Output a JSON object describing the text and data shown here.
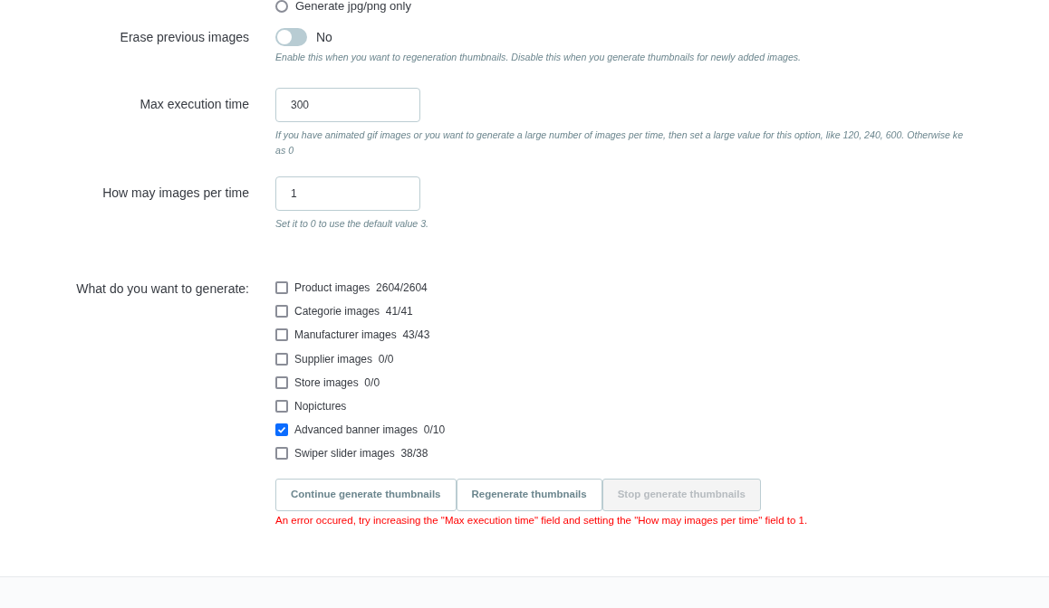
{
  "top_option": {
    "label": "Generate jpg/png only",
    "selected": false
  },
  "erase": {
    "label": "Erase previous images",
    "on": false,
    "state_text": "No",
    "help": "Enable this when you want to regeneration thumbnails. Disable this when you generate thumbnails for newly added images."
  },
  "max_time": {
    "label": "Max execution time",
    "value": "300",
    "help_lines": [
      "If you have animated gif images or you want to generate a large number of images per time, then set a large value for this option, like 120, 240, 600. Otherwise ke",
      "as 0"
    ]
  },
  "per_time": {
    "label": "How may images per time",
    "value": "1",
    "help": "Set it to 0 to use the default value 3."
  },
  "generate": {
    "label": "What do you want to generate:",
    "options": [
      {
        "label": "Product images",
        "count": "2604/2604",
        "checked": false
      },
      {
        "label": "Categorie images",
        "count": "41/41",
        "checked": false
      },
      {
        "label": "Manufacturer images",
        "count": "43/43",
        "checked": false
      },
      {
        "label": "Supplier images",
        "count": "0/0",
        "checked": false
      },
      {
        "label": "Store images",
        "count": "0/0",
        "checked": false
      },
      {
        "label": "Nopictures",
        "checked": false
      },
      {
        "label": "Advanced banner images",
        "count": "0/10",
        "checked": true
      },
      {
        "label": "Swiper slider images",
        "count": "38/38",
        "checked": false
      }
    ]
  },
  "buttons": [
    {
      "label": "Continue generate thumbnails",
      "disabled": false
    },
    {
      "label": "Regenerate thumbnails",
      "disabled": false
    },
    {
      "label": "Stop generate thumbnails",
      "disabled": true
    }
  ],
  "error": "An error occured, try increasing the \"Max execution time\" field and setting the \"How may images per time\" field to 1."
}
